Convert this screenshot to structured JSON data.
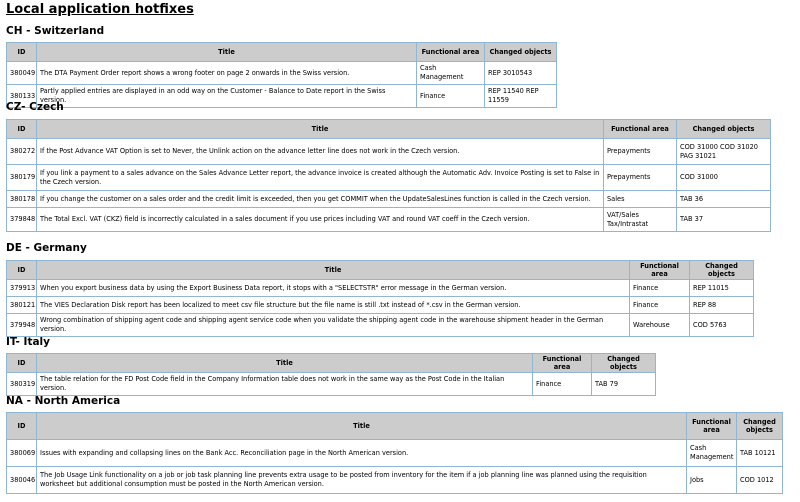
{
  "page_title": "Local application hotfixes",
  "columns": {
    "id": "ID",
    "title": "Title",
    "functional_area": "Functional area",
    "changed_objects": "Changed objects"
  },
  "sections": [
    {
      "heading": "CH - Switzerland",
      "rows": [
        {
          "id": "380049",
          "title": "The DTA Payment Order report shows a wrong footer on page 2 onwards in the Swiss version.",
          "area": "Cash Management",
          "objects": "REP 3010543"
        },
        {
          "id": "380133",
          "title": "Partly applied entries are displayed in an odd way on the Customer - Balance to Date report in the Swiss version.",
          "area": "Finance",
          "objects": "REP 11540 REP 11559"
        }
      ]
    },
    {
      "heading": "CZ- Czech",
      "rows": [
        {
          "id": "380272",
          "title": "If the Post Advance VAT Option is set to Never, the Unlink action on the advance letter line does not work in the Czech version.",
          "area": "Prepayments",
          "objects": "COD 31000 COD 31020 PAG 31021"
        },
        {
          "id": "380179",
          "title": "If you link a payment to a sales advance on the Sales Advance Letter report, the advance invoice is created although the Automatic Adv. Invoice Posting is set to False in the Czech version.",
          "area": "Prepayments",
          "objects": "COD 31000"
        },
        {
          "id": "380178",
          "title": "If you change the customer on a sales order and the credit limit is exceeded, then you get COMMIT when the UpdateSalesLines function is called in the Czech version.",
          "area": "Sales",
          "objects": "TAB 36"
        },
        {
          "id": "379848",
          "title": "The Total Excl. VAT (CKZ) field is incorrectly calculated in a sales document if you use prices including VAT and round VAT coeff in the Czech version.",
          "area": "VAT/Sales Tax/Intrastat",
          "objects": "TAB 37"
        }
      ]
    },
    {
      "heading": "DE - Germany",
      "rows": [
        {
          "id": "379913",
          "title": "When you export business data by using the Export Business Data report, it stops with a \"SELECTSTR\" error message in the German version.",
          "area": "Finance",
          "objects": "REP 11015"
        },
        {
          "id": "380121",
          "title": "The VIES Declaration Disk report has been localized to meet csv file structure but the file name is still .txt instead of *.csv in the German version.",
          "area": "Finance",
          "objects": "REP 88"
        },
        {
          "id": "379948",
          "title": "Wrong combination of shipping agent code and shipping agent service code when you validate the shipping agent code in the warehouse shipment header in the German version.",
          "area": "Warehouse",
          "objects": "COD 5763"
        }
      ]
    },
    {
      "heading": "IT- Italy",
      "rows": [
        {
          "id": "380319",
          "title": "The table relation for the FD Post Code field in the Company Information table does not work in the same way as the Post Code in the Italian version.",
          "area": "Finance",
          "objects": "TAB 79"
        }
      ]
    },
    {
      "heading": "NA - North America",
      "rows": [
        {
          "id": "380069",
          "title": "Issues with expanding and collapsing lines on the Bank Acc. Reconciliation page in the North American version.",
          "area": "Cash Management",
          "objects": "TAB 10121"
        },
        {
          "id": "380046",
          "title": "The Job Usage Link functionality on a job or job task planning line prevents extra usage to be posted from inventory for the item if a job planning line was planned using the requisition worksheet but additional consumption must be posted in the North American version.",
          "area": "Jobs",
          "objects": "COD 1012"
        }
      ]
    }
  ]
}
